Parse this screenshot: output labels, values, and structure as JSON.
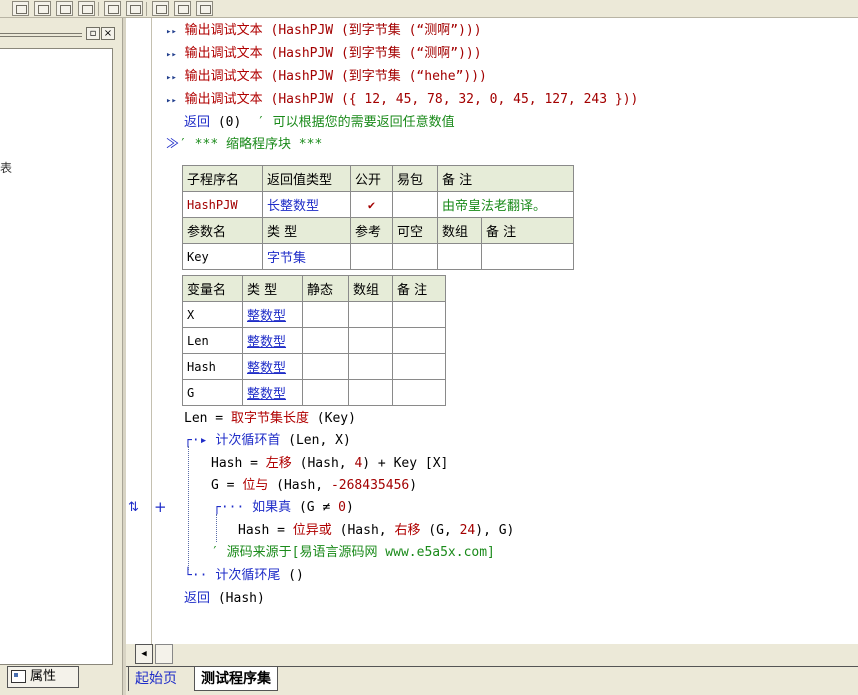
{
  "left_panel": {
    "content_text": "表",
    "tab_label": "属性"
  },
  "toolbar_glyphs": [
    "⊞",
    "⊟",
    "☷",
    "⊡",
    "⊢",
    "⊥",
    "↔",
    "↕",
    "⊕"
  ],
  "code": {
    "lines": [
      {
        "cmd": "输出调试文本",
        "args": " (HashPJW (到字节集 (“测啊”)))"
      },
      {
        "cmd": "输出调试文本",
        "args": " (HashPJW (到字节集 (“测啊”)))"
      },
      {
        "cmd": "输出调试文本",
        "args": " (HashPJW (到字节集 (“hehe”)))"
      },
      {
        "cmd": "输出调试文本",
        "args": " (HashPJW ({ 12, 45, 78, 32, 0, 45, 127, 243 }))"
      }
    ],
    "return_line": {
      "keyword": "返回",
      "args": " (0)  ",
      "comment": "′ 可以根据您的需要返回任意数值"
    },
    "collapsed_block": "′ *** 缩略程序块 ***"
  },
  "sub_table": {
    "headers": [
      "子程序名",
      "返回值类型",
      "公开",
      "易包",
      "备 注"
    ],
    "row": {
      "name": "HashPJW",
      "return_type": "长整数型",
      "public": "✔",
      "easy_pkg": "",
      "remark": "由帝皇法老翻译。"
    },
    "param_headers": [
      "参数名",
      "类 型",
      "参考",
      "可空",
      "数组",
      "备 注"
    ],
    "param_row": {
      "name": "Key",
      "type": "字节集"
    }
  },
  "var_table": {
    "headers": [
      "变量名",
      "类 型",
      "静态",
      "数组",
      "备 注"
    ],
    "rows": [
      {
        "name": "X",
        "type": "整数型"
      },
      {
        "name": "Len",
        "type": "整数型"
      },
      {
        "name": "Hash",
        "type": "整数型"
      },
      {
        "name": "G",
        "type": "整数型"
      }
    ]
  },
  "body": {
    "len_line": {
      "lhs": "Len = ",
      "func": "取字节集长度",
      "args": " (Key)"
    },
    "loop_head": {
      "func": "计次循环首",
      "args": " (Len, X)"
    },
    "hash_shift": {
      "lhs": "Hash = ",
      "func": "左移",
      "args_pre": " (Hash, ",
      "num": "4",
      "args_post": ") + Key [X]"
    },
    "g_and": {
      "lhs": "G = ",
      "func": "位与",
      "args_pre": " (Hash, ",
      "num": "-268435456",
      "args_post": ")"
    },
    "if_true": {
      "func": "如果真",
      "args": " (G ≠ ",
      "num": "0",
      "args_post": ")"
    },
    "hash_xor": {
      "lhs": "Hash = ",
      "func": "位异或",
      "args_pre": " (Hash, ",
      "func2": "右移",
      "args_mid": " (G, ",
      "num": "24",
      "args_post": "), G)"
    },
    "source_comment": "′ 源码来源于[易语言源码网 www.e5a5x.com]",
    "loop_tail": {
      "func": "计次循环尾",
      "args": " ()"
    },
    "return_hash": {
      "keyword": "返回",
      "args": " (Hash)"
    }
  },
  "gutter": {
    "mark": "⇅",
    "plus": "+"
  },
  "tabs": [
    {
      "label": "起始页"
    },
    {
      "label": "测试程序集"
    }
  ]
}
